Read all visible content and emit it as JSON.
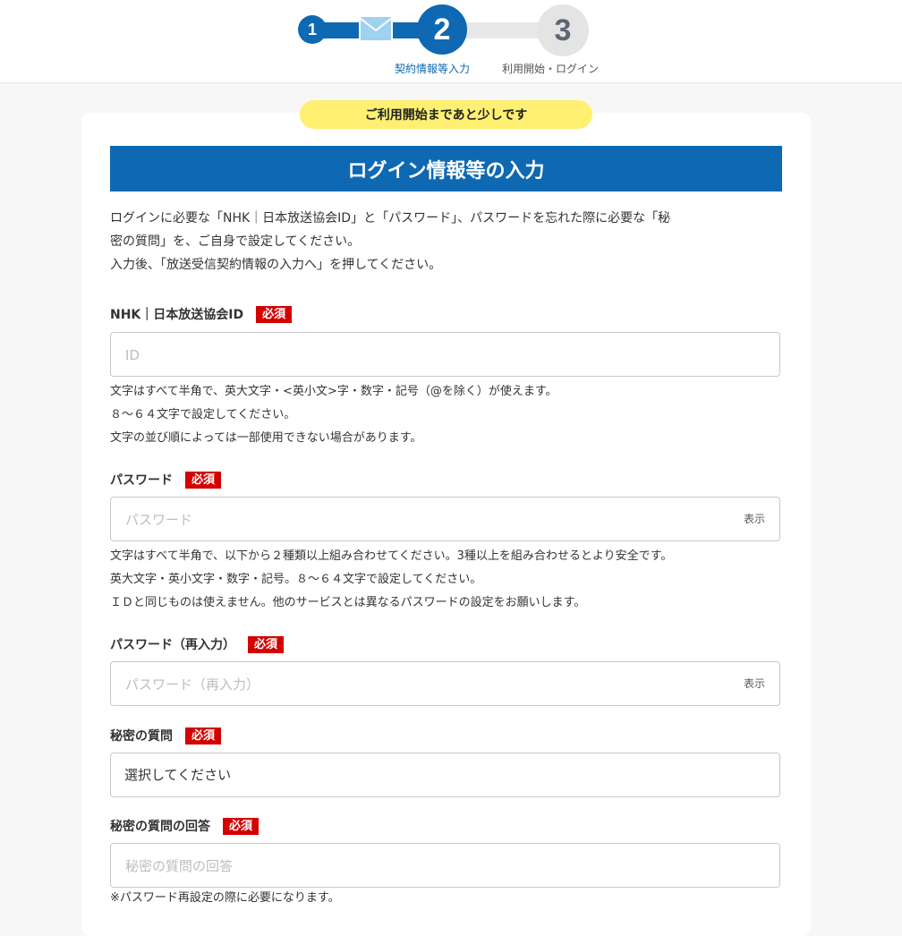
{
  "stepper": {
    "steps": [
      {
        "number": "1"
      },
      {
        "number": "2",
        "label": "契約情報等入力"
      },
      {
        "number": "3",
        "label": "利用開始・ログイン"
      }
    ]
  },
  "colors": {
    "primary": "#0e69b2",
    "required": "#d50000",
    "notice": "#fff071"
  },
  "notice_pill": "ご利用開始まであと少しです",
  "banner_title": "ログイン情報等の入力",
  "intro": [
    "ログインに必要な「NHK｜日本放送協会ID」と「パスワード」、パスワードを忘れた際に必要な「秘",
    "密の質問」を、ご自身で設定してください。",
    "入力後、「放送受信契約情報の入力へ」を押してください。"
  ],
  "required_badge": "必須",
  "fields": {
    "id": {
      "label": "NHK｜日本放送協会ID",
      "placeholder": "ID",
      "hints": [
        "文字はすべて半角で、英大文字・<英小文>字・数字・記号（@を除く）が使えます。",
        "８～６４文字で設定してください。",
        "文字の並び順によっては一部使用できない場合があります。"
      ]
    },
    "password": {
      "label": "パスワード",
      "placeholder": "パスワード",
      "show_label": "表示",
      "hints": [
        "文字はすべて半角で、以下から２種類以上組み合わせてください。3種以上を組み合わせるとより安全です。",
        "英大文字・英小文字・数字・記号。８～６４文字で設定してください。",
        "ＩＤと同じものは使えません。他のサービスとは異なるパスワードの設定をお願いします。"
      ]
    },
    "password_confirm": {
      "label": "パスワード（再入力）",
      "placeholder": "パスワード（再入力）",
      "show_label": "表示"
    },
    "secret_question": {
      "label": "秘密の質問",
      "selected": "選択してください"
    },
    "secret_answer": {
      "label": "秘密の質問の回答",
      "placeholder": "秘密の質問の回答",
      "hint": "※パスワード再設定の際に必要になります。"
    }
  }
}
